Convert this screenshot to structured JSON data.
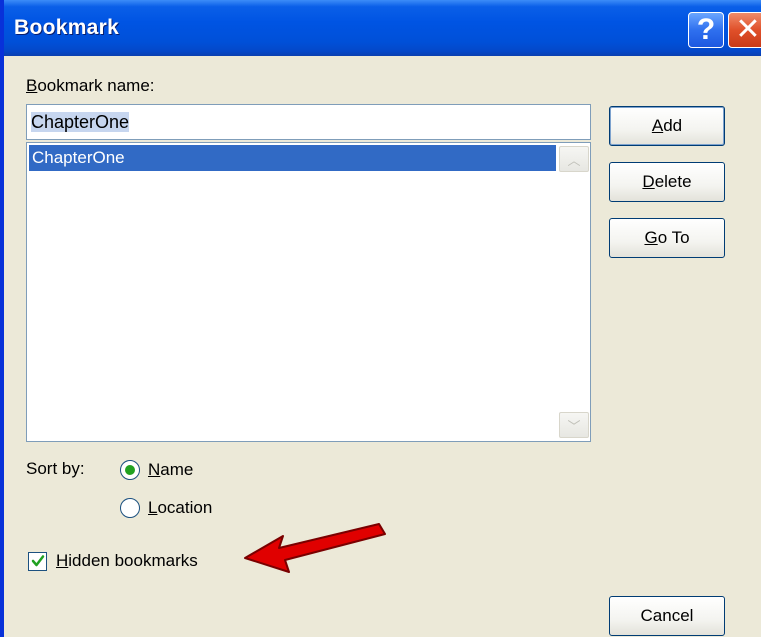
{
  "window": {
    "title": "Bookmark",
    "help_glyph": "?",
    "close_glyph": "✕"
  },
  "bookmark_name": {
    "label_hotkey": "B",
    "label_rest": "ookmark name:",
    "value": "ChapterOne"
  },
  "bookmark_list": {
    "items": [
      "ChapterOne"
    ],
    "selected_index": 0
  },
  "buttons": {
    "add": {
      "hotkey": "A",
      "rest": "dd"
    },
    "delete": {
      "hotkey": "D",
      "rest": "elete"
    },
    "goto": {
      "hotkey": "G",
      "rest": "o To"
    },
    "cancel": "Cancel"
  },
  "sort": {
    "label": "Sort by:",
    "options": [
      {
        "hotkey": "N",
        "rest": "ame",
        "selected": true
      },
      {
        "hotkey": "L",
        "rest": "ocation",
        "selected": false
      }
    ]
  },
  "hidden_bookmarks": {
    "hotkey": "H",
    "rest": "idden bookmarks",
    "checked": true
  },
  "annotation": {
    "arrow_color": "#e00000",
    "arrow_target": "hidden-bookmarks-checkbox"
  },
  "colors": {
    "titlebar": "#0054e3",
    "selection": "#316ac5",
    "dialog_bg": "#ece9d8",
    "radio_dot": "#21a121",
    "check": "#21a121"
  }
}
